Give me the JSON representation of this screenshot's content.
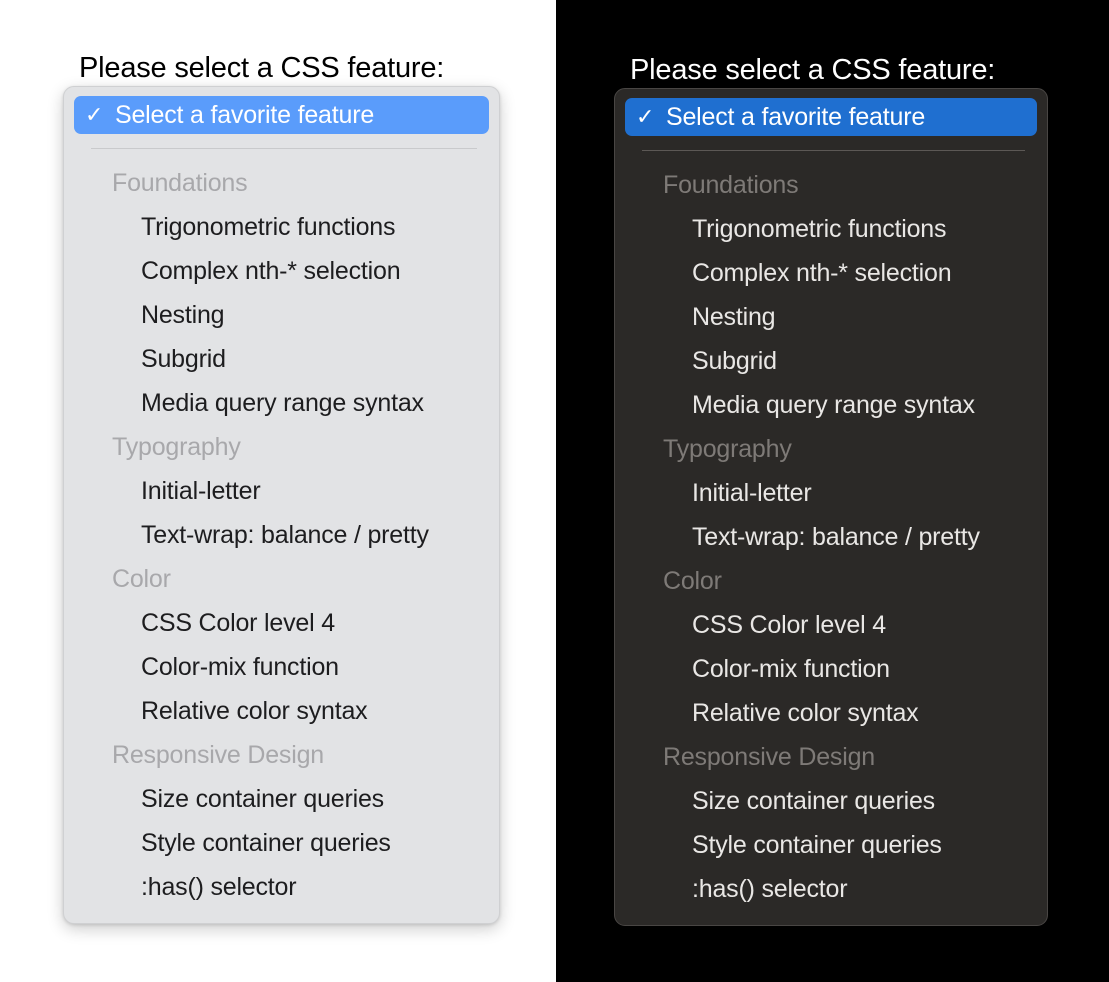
{
  "panels": [
    {
      "theme": "light",
      "prompt": "Please select a CSS feature:"
    },
    {
      "theme": "dark",
      "prompt": "Please select a CSS feature:"
    }
  ],
  "select_menu": {
    "selected_option": {
      "label": "Select a favorite feature",
      "check_glyph": "✓",
      "checked": true
    },
    "groups": [
      {
        "label": "Foundations",
        "options": [
          "Trigonometric functions",
          "Complex nth-* selection",
          "Nesting",
          "Subgrid",
          "Media query range syntax"
        ]
      },
      {
        "label": "Typography",
        "options": [
          "Initial-letter",
          "Text-wrap: balance / pretty"
        ]
      },
      {
        "label": "Color",
        "options": [
          "CSS Color level 4",
          "Color-mix function",
          "Relative color syntax"
        ]
      },
      {
        "label": "Responsive Design",
        "options": [
          "Size container queries",
          "Style container queries",
          ":has() selector"
        ]
      }
    ]
  },
  "colors": {
    "light_panel_bg": "#e2e3e5",
    "light_highlight": "#5a9cfb",
    "light_group_label": "#a8a8ab",
    "light_option_text": "#1d1d1f",
    "dark_panel_bg": "#2b2927",
    "dark_highlight": "#1f6fd0",
    "dark_group_label": "#7e7a77",
    "dark_option_text": "#e9e7e5",
    "light_backdrop": "#ffffff",
    "dark_backdrop": "#000000"
  }
}
